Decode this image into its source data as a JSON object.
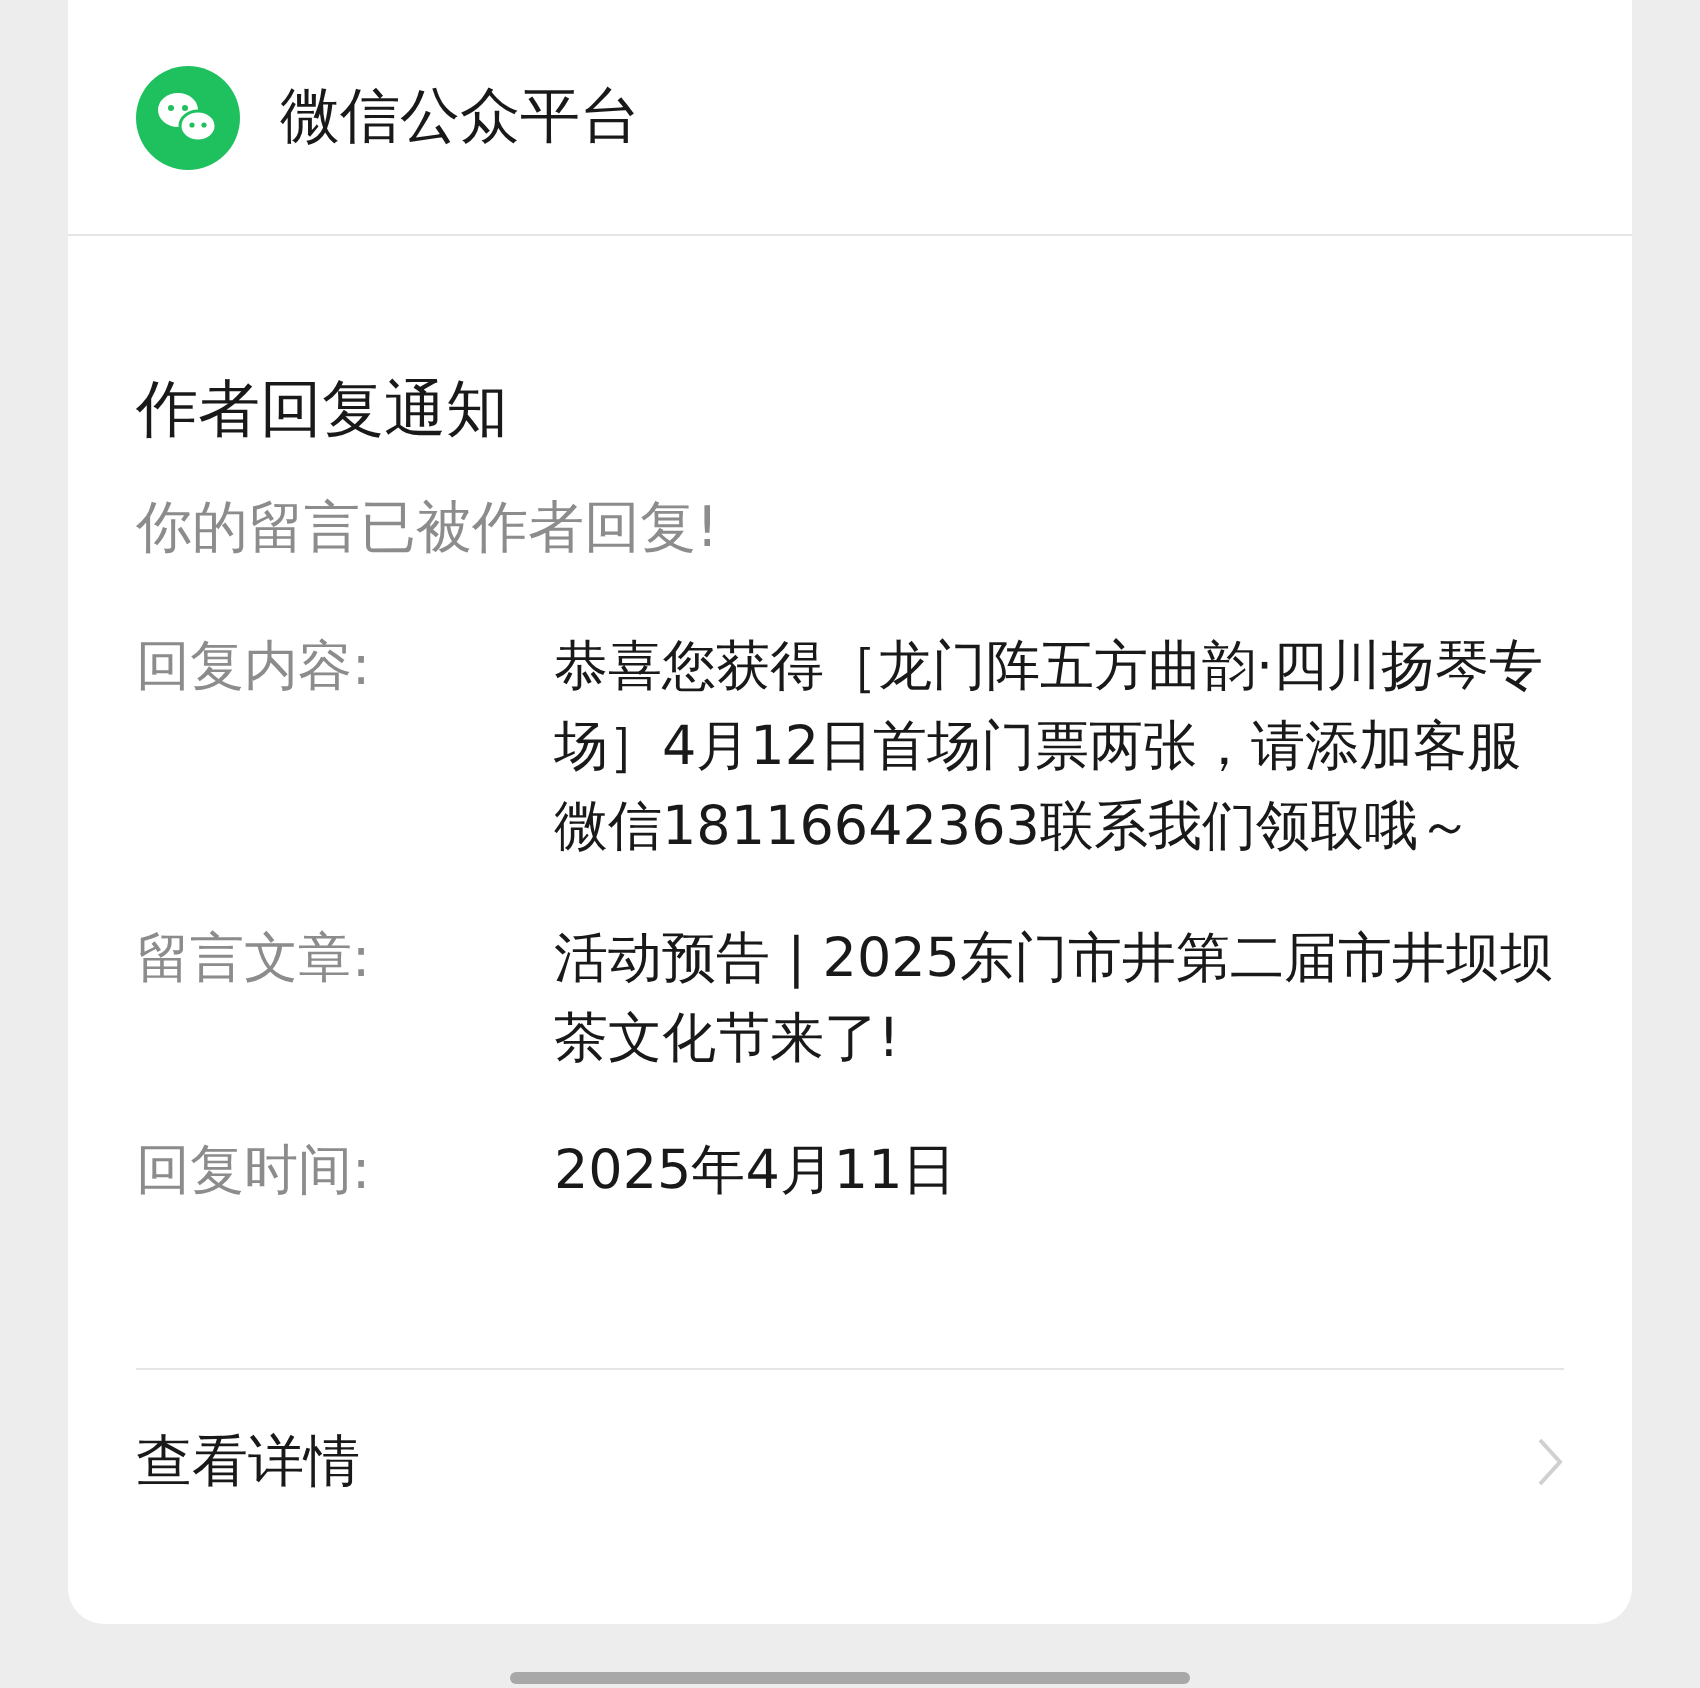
{
  "header": {
    "title": "微信公众平台"
  },
  "notice": {
    "title": "作者回复通知",
    "subtitle": "你的留言已被作者回复!",
    "rows": [
      {
        "label": "回复内容:",
        "value": "恭喜您获得［龙门阵五方曲韵·四川扬琴专场］4月12日首场门票两张，请添加客服微信18116642363联系我们领取哦～"
      },
      {
        "label": "留言文章:",
        "value": "活动预告 | 2025东门市井第二届市井坝坝茶文化节来了!"
      },
      {
        "label": "回复时间:",
        "value": "2025年4月11日"
      }
    ]
  },
  "footer": {
    "link": "查看详情"
  }
}
